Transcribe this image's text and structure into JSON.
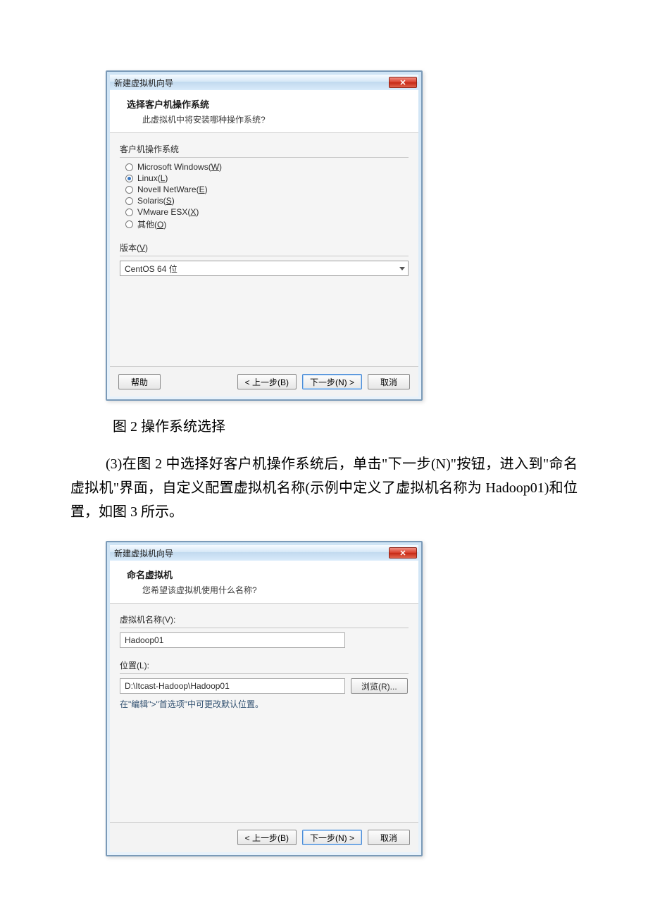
{
  "fig2_caption": "图 2 操作系统选择",
  "paragraph_text": "(3)在图 2 中选择好客户机操作系统后，单击\"下一步(N)\"按钮，进入到\"命名虚拟机\"界面，自定义配置虚拟机名称(示例中定义了虚拟机名称为 Hadoop01)和位置，如图 3 所示。",
  "dialog1": {
    "title": "新建虚拟机向导",
    "header_title": "选择客户机操作系统",
    "header_sub": "此虚拟机中将安装哪种操作系统?",
    "section_os": "客户机操作系统",
    "radios": [
      {
        "label_prefix": "Microsoft Windows(",
        "hotkey": "W",
        "label_suffix": ")",
        "selected": false
      },
      {
        "label_prefix": "Linux(",
        "hotkey": "L",
        "label_suffix": ")",
        "selected": true
      },
      {
        "label_prefix": "Novell NetWare(",
        "hotkey": "E",
        "label_suffix": ")",
        "selected": false
      },
      {
        "label_prefix": "Solaris(",
        "hotkey": "S",
        "label_suffix": ")",
        "selected": false
      },
      {
        "label_prefix": "VMware ESX(",
        "hotkey": "X",
        "label_suffix": ")",
        "selected": false
      },
      {
        "label_prefix": "其他(",
        "hotkey": "O",
        "label_suffix": ")",
        "selected": false
      }
    ],
    "version_label_prefix": "版本(",
    "version_hotkey": "V",
    "version_label_suffix": ")",
    "version_value": "CentOS 64 位",
    "btn_help": "帮助",
    "btn_back": "< 上一步(B)",
    "btn_next": "下一步(N) >",
    "btn_cancel": "取消"
  },
  "dialog2": {
    "title": "新建虚拟机向导",
    "header_title": "命名虚拟机",
    "header_sub": "您希望该虚拟机使用什么名称?",
    "name_label": "虚拟机名称(V):",
    "name_value": "Hadoop01",
    "loc_label": "位置(L):",
    "loc_value": "D:\\Itcast-Hadoop\\Hadoop01",
    "browse_btn": "浏览(R)...",
    "note": "在\"编辑\">\"首选项\"中可更改默认位置。",
    "btn_back": "< 上一步(B)",
    "btn_next": "下一步(N) >",
    "btn_cancel": "取消"
  }
}
